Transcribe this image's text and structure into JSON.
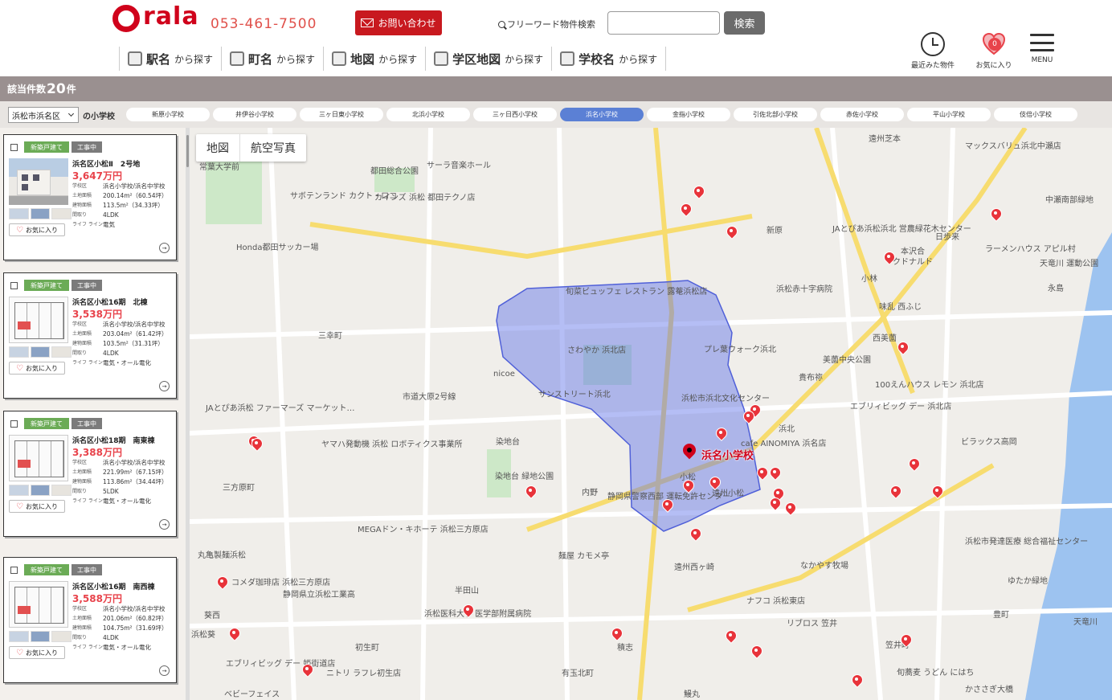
{
  "brand": {
    "logo_text": "rala",
    "phone": "053-461-7500"
  },
  "header": {
    "contact_label": "お問い合わせ",
    "search_label": "フリーワード物件検索",
    "search_value": "",
    "search_button": "検索",
    "history_label": "最近みた物件",
    "favorites_label": "お気に入り",
    "favorites_count": "0",
    "menu_label": "MENU"
  },
  "nav": [
    {
      "main": "駅名",
      "sub": "から探す"
    },
    {
      "main": "町名",
      "sub": "から探す"
    },
    {
      "main": "地図",
      "sub": "から探す"
    },
    {
      "main": "学区地図",
      "sub": "から探す"
    },
    {
      "main": "学校名",
      "sub": "から探す"
    }
  ],
  "results": {
    "prefix": "該当件数",
    "count": "20",
    "suffix": "件"
  },
  "school_filter": {
    "ward": "浜松市浜名区",
    "suffix": "の小学校",
    "tabs": [
      "新原小学校",
      "井伊谷小学校",
      "三ヶ日東小学校",
      "北浜小学校",
      "三ヶ日西小学校",
      "浜名小学校",
      "金指小学校",
      "引佐北部小学校",
      "赤佐小学校",
      "平山小学校",
      "伎倍小学校"
    ],
    "active_tab": "浜名小学校"
  },
  "card_labels": {
    "badge_new": "新築戸建て",
    "badge_work": "工事中",
    "school": "学校区",
    "land": "土地面積",
    "building": "建物面積",
    "layout": "間取り",
    "utility": "ライフ ライン",
    "fav": "お気に入り"
  },
  "listings": [
    {
      "title": "浜名区小松Ⅱ　2号地",
      "price": "3,647万円",
      "school": "浜名小学校/浜名中学校",
      "land": "200.14m²（60.54坪）",
      "building": "113.5m²（34.33坪）",
      "layout": "4LDK",
      "utility": "電気"
    },
    {
      "title": "浜名区小松16期　北棟",
      "price": "3,538万円",
      "school": "浜名小学校/浜名中学校",
      "land": "203.04m²（61.42坪）",
      "building": "103.5m²（31.31坪）",
      "layout": "4LDK",
      "utility": "電気・オール電化"
    },
    {
      "title": "浜名区小松18期　南東棟",
      "price": "3,388万円",
      "school": "浜名小学校/浜名中学校",
      "land": "221.99m²（67.15坪）",
      "building": "113.86m²（34.44坪）",
      "layout": "5LDK",
      "utility": "電気・オール電化"
    },
    {
      "title": "浜名区小松16期　南西棟",
      "price": "3,588万円",
      "school": "浜名小学校/浜名中学校",
      "land": "201.06m²（60.82坪）",
      "building": "104.75m²（31.69坪）",
      "layout": "4LDK",
      "utility": "電気・オール電化"
    }
  ],
  "map": {
    "toggle_map": "地図",
    "toggle_aerial": "航空写真",
    "school_label": "浜名小学校",
    "labels": [
      "常葉大学前",
      "都田総合公園",
      "サーラ音楽ホール",
      "サボテンランド カクト・ロコ",
      "カインズ 浜松 都田テクノ店",
      "Honda都田サッカー場",
      "新原",
      "遠州芝本",
      "マックスバリュ浜北中瀬店",
      "中瀬南部緑地",
      "JAとぴあ浜松浜北 営農緑花木センター",
      "日歩来",
      "本沢合",
      "マクドナルド",
      "ラーメンハウス アピル村",
      "天竜川 運動公園",
      "浜松赤十字病院",
      "小林",
      "永島",
      "味乱 西ふじ",
      "旬菜ビュッフェ レストラン 露菴浜松店",
      "三幸町",
      "さわやか 浜北店",
      "プレ葉ウォーク浜北",
      "美薗中央公園",
      "貴布祢",
      "西美薗",
      "100えんハウス レモン 浜北店",
      "nicoe",
      "サンストリート浜北",
      "浜松市浜北文化センター",
      "エブリィビッグ デー 浜北店",
      "JAとぴあ浜松 ファーマーズ マーケット…",
      "ヤマハ発動機 浜松 ロボティクス事業所",
      "市道大原2号線",
      "染地台",
      "染地台 緑地公園",
      "cafe AINOMIYA 浜名店",
      "浜北",
      "ビラックス高岡",
      "内野",
      "静岡県警察西部 運転免許センター",
      "小松",
      "遠州小松",
      "三方原町",
      "MEGAドン・キホーテ 浜松三方原店",
      "丸亀製麺浜松",
      "コメダ珈琲店 浜松三方原店",
      "麺屋 カモメ亭",
      "遠州西ヶ崎",
      "なかやす牧場",
      "浜松市発達医療 総合福祉センター",
      "ゆたか緑地",
      "静岡県立浜松工業高",
      "半田山",
      "浜松医科大学 医学部附属病院",
      "ナフコ 浜松東店",
      "リブロス 笠井",
      "葵西",
      "初生町",
      "積志",
      "有玉北町",
      "笠井町",
      "豊町",
      "旬蕎麦 うどん にはち",
      "かささぎ大橋",
      "エブリィビッグ デー 姫街道店",
      "ニトリ ラフレ初生店",
      "浜松葵",
      "ベビーフェイス",
      "鰻丸",
      "天竜川"
    ]
  }
}
